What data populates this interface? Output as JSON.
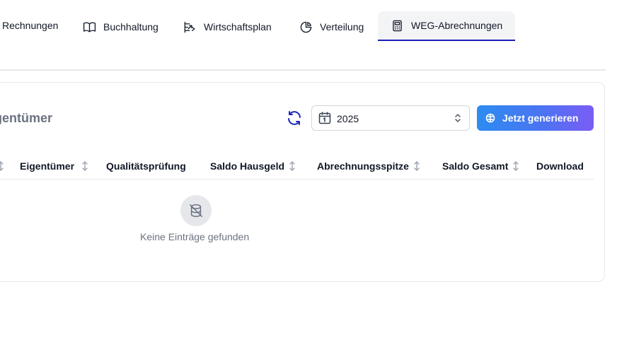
{
  "tabs": [
    {
      "label": "Rechnungen",
      "icon": "invoice-icon",
      "active": false
    },
    {
      "label": "Buchhaltung",
      "icon": "book-icon",
      "active": false
    },
    {
      "label": "Wirtschaftsplan",
      "icon": "plan-icon",
      "active": false
    },
    {
      "label": "Verteilung",
      "icon": "pie-chart-icon",
      "active": false
    },
    {
      "label": "WEG-Abrechnungen",
      "icon": "calculator-icon",
      "active": true
    }
  ],
  "card": {
    "title": "igentümer",
    "year_select": {
      "value": "2025"
    },
    "generate_button": {
      "label": "Jetzt generieren"
    }
  },
  "table": {
    "columns": [
      {
        "label": "",
        "sortable": true
      },
      {
        "label": "Eigentümer",
        "sortable": true
      },
      {
        "label": "Qualitätsprüfung",
        "sortable": false
      },
      {
        "label": "Saldo Hausgeld",
        "sortable": true
      },
      {
        "label": "Abrechnungsspitze",
        "sortable": true
      },
      {
        "label": "Saldo Gesamt",
        "sortable": true
      },
      {
        "label": "Download",
        "sortable": false
      }
    ],
    "empty_text": "Keine Einträge gefunden"
  },
  "colors": {
    "active_tab_underline": "#1d1db8",
    "refresh_icon": "#1d2bb8",
    "button_gradient_start": "#2d8cf0",
    "button_gradient_end": "#7b5cf5"
  }
}
